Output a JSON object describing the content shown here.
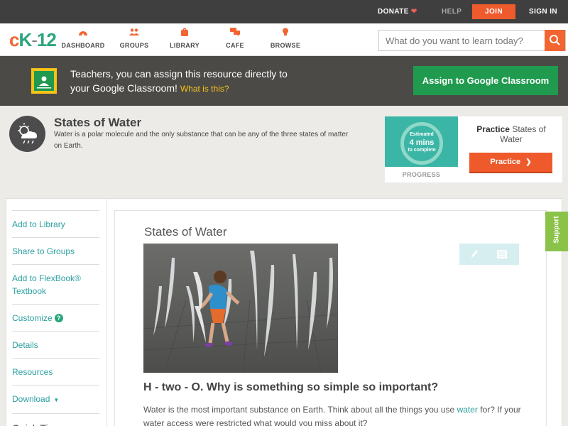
{
  "topbar": {
    "donate": "DONATE",
    "help": "HELP",
    "join": "JOIN",
    "signin": "SIGN IN"
  },
  "nav": {
    "logo": {
      "c": "c",
      "k": "K",
      "dash": "-",
      "num": "12"
    },
    "items": [
      {
        "label": "DASHBOARD",
        "icon": "gauge-icon"
      },
      {
        "label": "GROUPS",
        "icon": "group-icon"
      },
      {
        "label": "LIBRARY",
        "icon": "bag-icon"
      },
      {
        "label": "CAFE",
        "icon": "chat-icon"
      },
      {
        "label": "BROWSE",
        "icon": "lightbulb-icon"
      }
    ],
    "search_placeholder": "What do you want to learn today?"
  },
  "banner": {
    "text_line1": "Teachers, you can assign this resource directly to",
    "text_line2": "your Google Classroom!",
    "what_is_this": "What is this?",
    "assign_label": "Assign to Google Classroom"
  },
  "concept": {
    "title": "States of Water",
    "description": "Water is a polar molecule and the only substance that can be any of the three states of matter on Earth."
  },
  "practice": {
    "estimated": "Estimated",
    "mins": "4 mins",
    "to_complete": "to complete",
    "progress_label": "PROGRESS",
    "title_bold": "Practice",
    "title_rest": "States of Water",
    "button_label": "Practice"
  },
  "sidebar": {
    "items": [
      {
        "label": "Add to Library"
      },
      {
        "label": "Share to Groups"
      },
      {
        "label": "Add to FlexBook® Textbook"
      },
      {
        "label": "Customize"
      },
      {
        "label": "Details"
      },
      {
        "label": "Resources"
      },
      {
        "label": "Download"
      }
    ],
    "quick_tips": "Quick Tips"
  },
  "article": {
    "title": "States of Water",
    "subheading": "H - two - O. Why is something so simple so important?",
    "para_before": "Water is the most important substance on Earth. Think about all the things you use ",
    "para_link": "water",
    "para_after": " for? If your water access were restricted what would you miss about it?"
  },
  "support_label": "Support",
  "colors": {
    "accent_orange": "#ee5a2c",
    "google_green": "#1f9a4e",
    "link_teal": "#2a9fa0",
    "support_green": "#8bc34a"
  }
}
